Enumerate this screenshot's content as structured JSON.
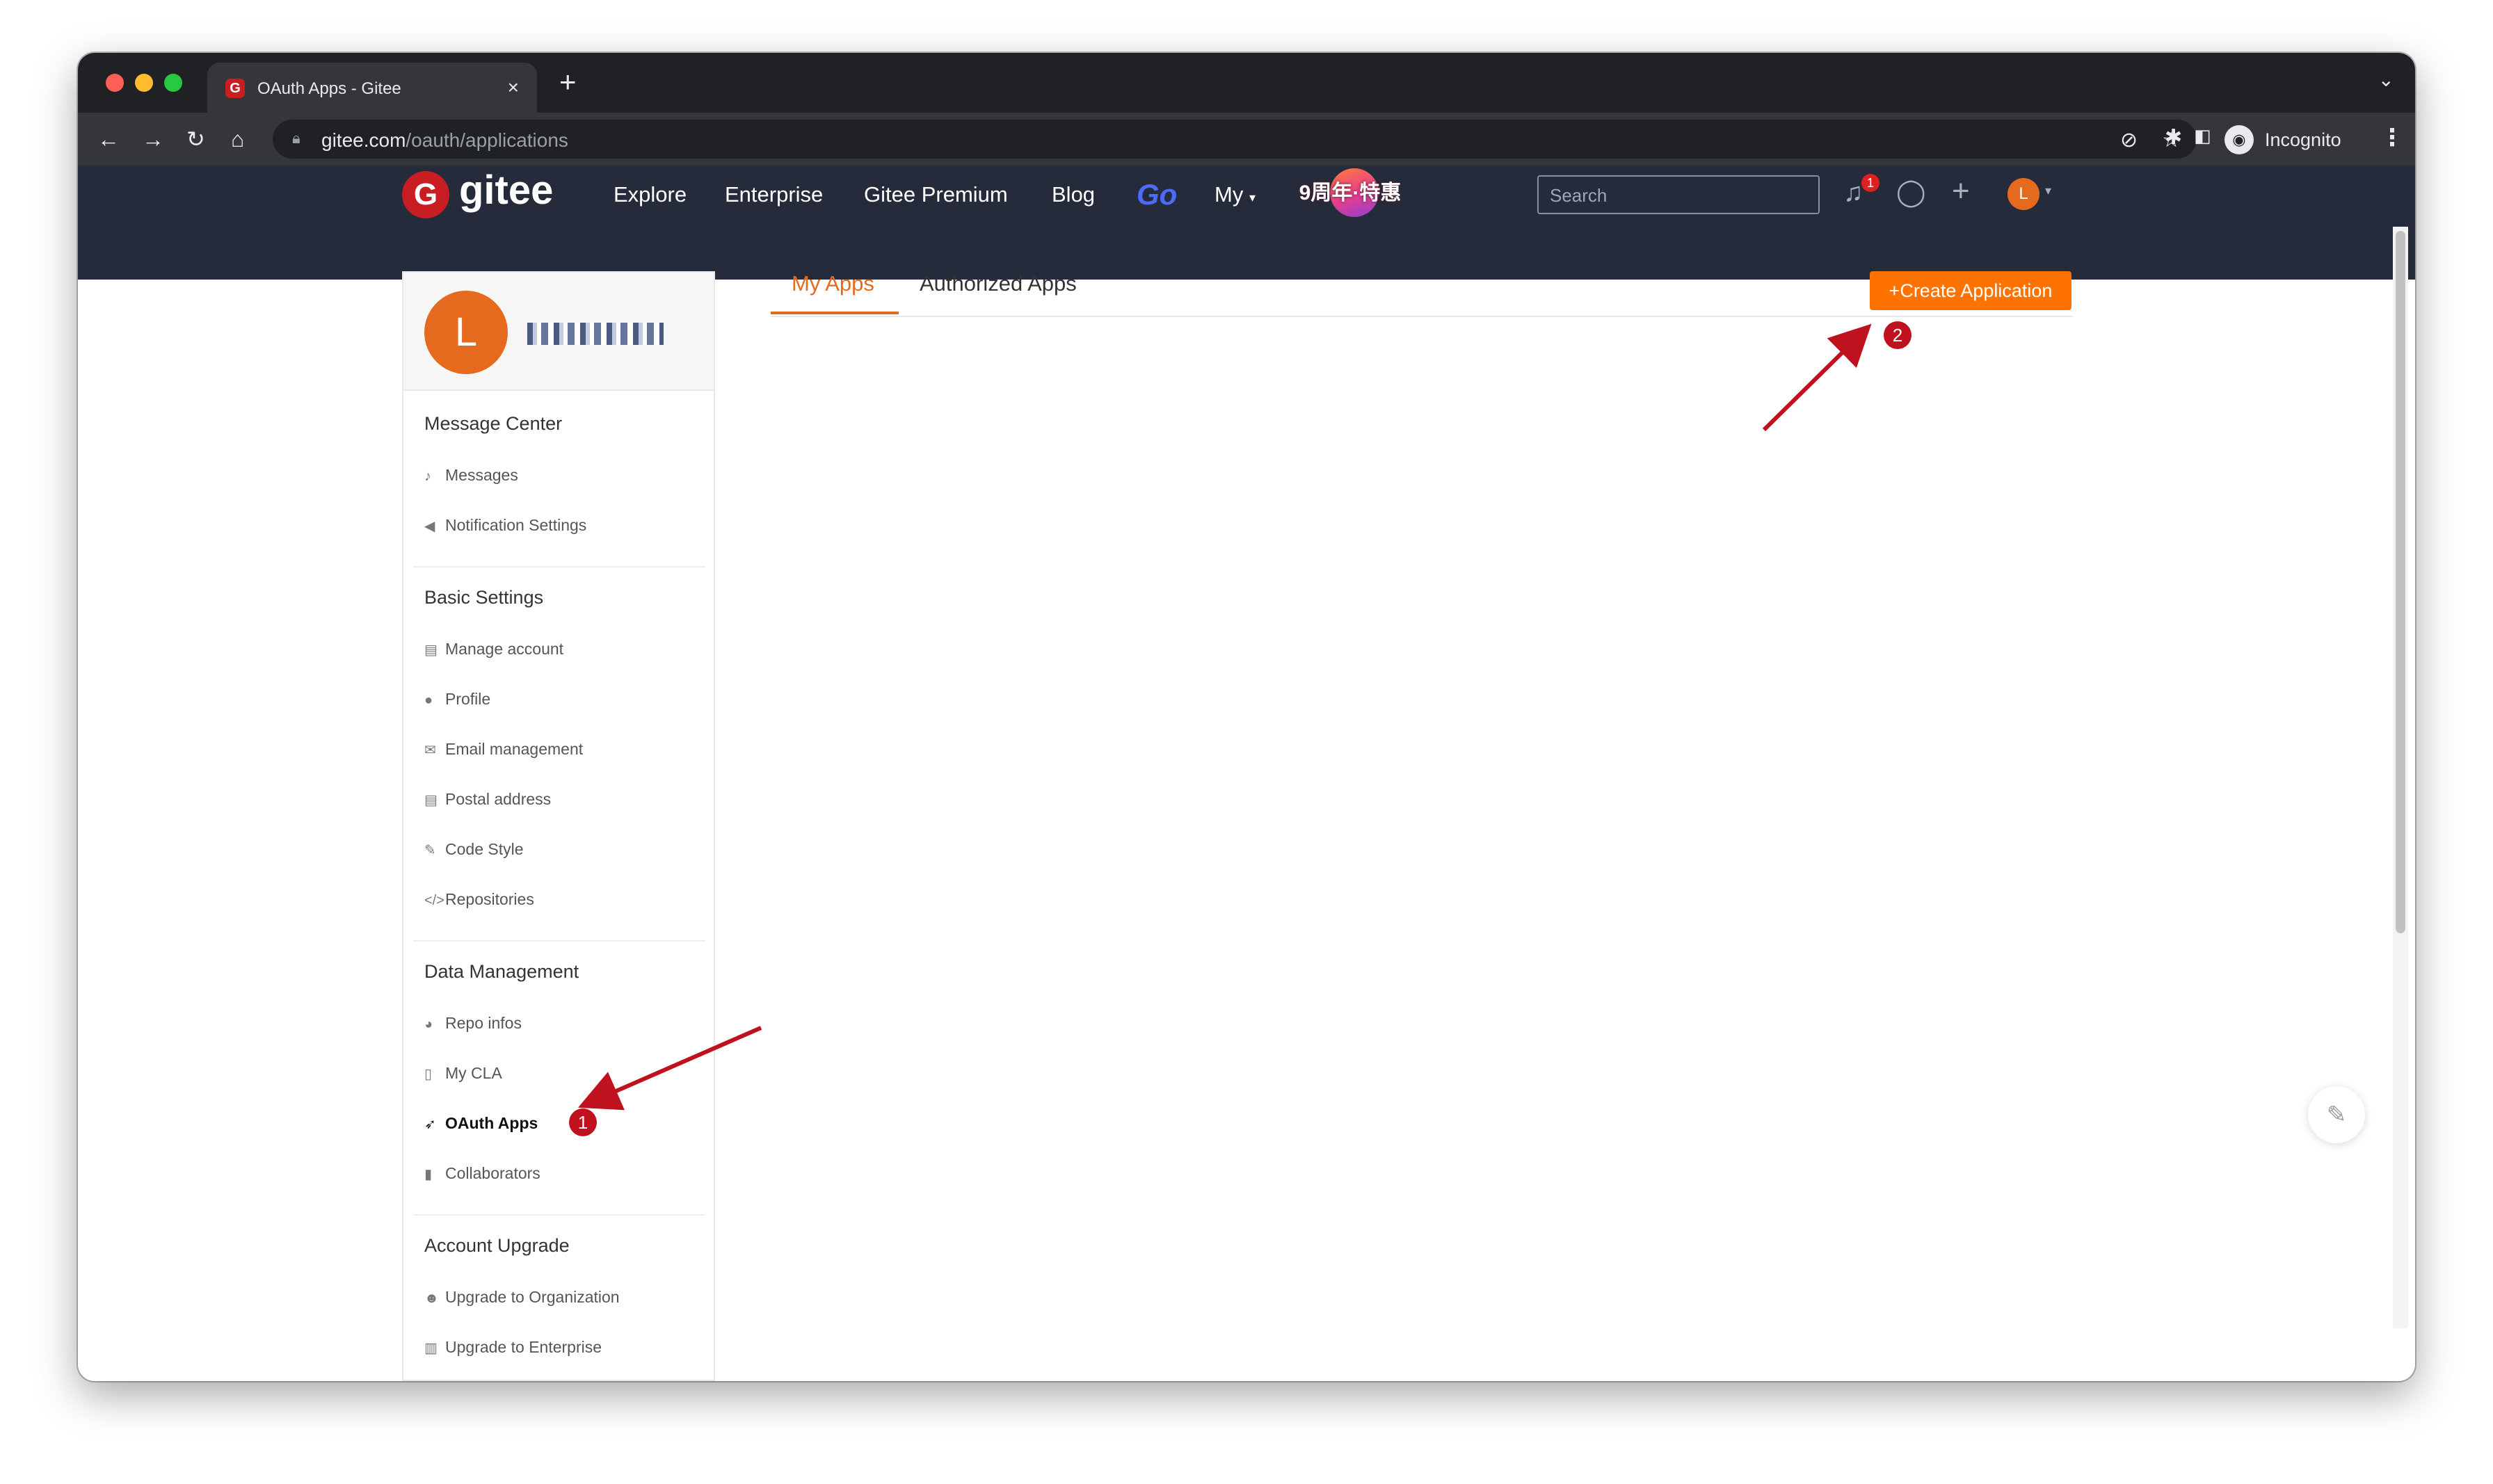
{
  "browser": {
    "tab_title": "OAuth Apps - Gitee",
    "tab_favicon": "G",
    "new_tab_icon": "+",
    "close_icon": "×",
    "url_domain": "gitee.com",
    "url_path": "/oauth/applications",
    "incognito_label": "Incognito"
  },
  "header": {
    "logo_mark": "G",
    "logo_text": "gitee",
    "nav": [
      "Explore",
      "Enterprise",
      "Gitee Premium",
      "Blog"
    ],
    "go_label": "Go",
    "my_label": "My",
    "promo_text": "9周年·特惠",
    "search_placeholder": "Search",
    "notification_count": "1",
    "avatar_letter": "L"
  },
  "sidebar": {
    "avatar_letter": "L",
    "sections": [
      {
        "title": "Message Center",
        "items": [
          "Messages",
          "Notification Settings"
        ]
      },
      {
        "title": "Basic Settings",
        "items": [
          "Manage account",
          "Profile",
          "Email management",
          "Postal address",
          "Code Style",
          "Repositories"
        ]
      },
      {
        "title": "Data Management",
        "items": [
          "Repo infos",
          "My CLA",
          "OAuth Apps",
          "Collaborators"
        ]
      },
      {
        "title": "Account Upgrade",
        "items": [
          "Upgrade to Organization",
          "Upgrade to Enterprise"
        ]
      }
    ]
  },
  "main": {
    "tabs": [
      "My Apps",
      "Authorized Apps"
    ],
    "create_button": "+Create Application"
  },
  "annotations": {
    "step1": "1",
    "step2": "2",
    "arrow_color": "#c0121e"
  },
  "colors": {
    "accent": "#e56a1d",
    "button": "#fe7300",
    "header_bg": "#252b3a",
    "brand_red": "#c71d23"
  }
}
